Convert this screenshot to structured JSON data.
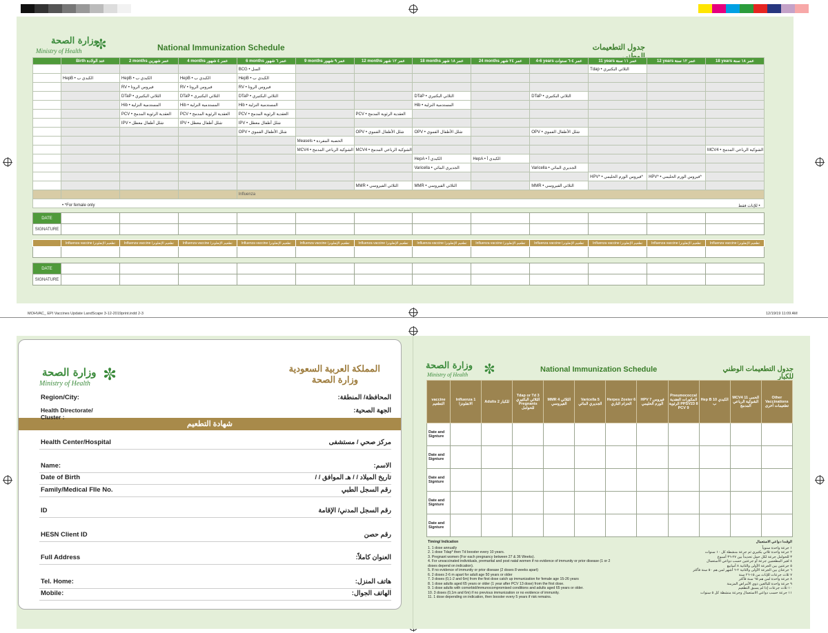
{
  "top_sheet": {
    "logo_ar": "وزارة الصحة",
    "logo_en": "Ministry of Health",
    "title_en": "National Immunization Schedule",
    "title_ar": "جدول التطعيمات الوطني",
    "columns": [
      "Birth عند الولادة",
      "2 months عمر شهرين",
      "4 months عمر ٤ شهور",
      "6 months عمر ٦ شهور",
      "9 months عمر ٩ شهور",
      "12 months عمر ١٢ شهر",
      "18 months عمر ١٨ شهر",
      "24 months عمر ٢٤ شهر",
      "4-6 years عمر ٤-٦ سنوات",
      "11 years عمر ١١ سنة",
      "12 years عمر ١٢ سنة",
      "18 years عمر ١٨ سنة"
    ],
    "rows": [
      [
        "",
        "",
        "",
        "BCG • السل",
        "",
        "",
        "",
        "",
        "",
        "Tdap • الثلاثي البكتيري",
        "",
        ""
      ],
      [
        "HepB • الكبدي ب",
        "HepB • الكبدي ب",
        "HepB • الكبدي ب",
        "HepB • الكبدي ب",
        "",
        "",
        "",
        "",
        "",
        "",
        "",
        ""
      ],
      [
        "",
        "RV • فيروس الروتا",
        "RV • فيروس الروتا",
        "RV • فيروس الروتا",
        "",
        "",
        "",
        "",
        "",
        "",
        "",
        ""
      ],
      [
        "",
        "DTaP • الثلاثي البكتيري",
        "DTaP • الثلاثي البكتيري",
        "DTaP • الثلاثي البكتيري",
        "",
        "",
        "DTaP • الثلاثي البكتيري",
        "",
        "DTaP • الثلاثي البكتيري",
        "",
        "",
        ""
      ],
      [
        "",
        "Hib • المستدمية النزلية",
        "Hib • المستدمية النزلية",
        "Hib • المستدمية النزلية",
        "",
        "",
        "Hib • المستدمية النزلية",
        "",
        "",
        "",
        "",
        ""
      ],
      [
        "",
        "PCV • العقدية الرئوية المدمج",
        "PCV • العقدية الرئوية المدمج",
        "PCV • العقدية الرئوية المدمج",
        "",
        "PCV • العقدية الرئوية المدمج",
        "",
        "",
        "",
        "",
        "",
        ""
      ],
      [
        "",
        "IPV • شلل أطفال معطل",
        "IPV • شلل أطفال معطل",
        "IPV • شلل أطفال معطل",
        "",
        "",
        "",
        "",
        "",
        "",
        "",
        ""
      ],
      [
        "",
        "",
        "",
        "OPV • شلل الأطفال الفموي",
        "",
        "OPV • شلل الأطفال الفموي",
        "OPV • شلل الأطفال الفموي",
        "",
        "OPV • شلل الأطفال الفموي",
        "",
        "",
        ""
      ],
      [
        "",
        "",
        "",
        "",
        "Measels • الحصبة المفردة",
        "",
        "",
        "",
        "",
        "",
        "",
        ""
      ],
      [
        "",
        "",
        "",
        "",
        "MCV4 • الحمى الشوكية الرباعي المدمج",
        "MCV4 • الحمى الشوكية الرباعي المدمج",
        "",
        "",
        "",
        "",
        "",
        "MCV4 • الحمى الشوكية الرباعي المدمج"
      ],
      [
        "",
        "",
        "",
        "",
        "",
        "",
        "HepA • الكبدي أ",
        "HepA • الكبدي أ",
        "",
        "",
        "",
        ""
      ],
      [
        "",
        "",
        "",
        "",
        "",
        "",
        "Varicella • الجديري المائي",
        "",
        "Varicella • الجديري المائي",
        "",
        "",
        ""
      ],
      [
        "",
        "",
        "",
        "",
        "",
        "",
        "",
        "",
        "",
        "HPV* • فيروس الورم الحليمي*",
        "HPV* • فيروس الورم الحليمي*",
        ""
      ],
      [
        "",
        "",
        "",
        "",
        "",
        "MMR • الثلاثي الفيروسي",
        "MMR • الثلاثي الفيروسي",
        "",
        "MMR • الثلاثي الفيروسي",
        "",
        "",
        ""
      ]
    ],
    "influenza_row": "Influenza",
    "footnote_en": "• *For female only",
    "footnote_ar": "• للإناث فقط",
    "date_label": "DATE",
    "signature_label": "SIGNATURE",
    "influenza_cols": "Influenza vaccine تطعيم الإنفلونزا"
  },
  "print_slug": {
    "file": "MOHVAC_ EPI Vaccines Update LandScape 3-12-2019print.indd   2-3",
    "date": "12/19/19   11:09 AM"
  },
  "certificate": {
    "kingdom_ar": "المملكة العربية السعودية",
    "ministry_ar": "وزارة الصحة",
    "logo_ar": "وزارة الصحة",
    "logo_en": "Ministry of Health",
    "banner": "شهادة التطعيم",
    "fields": [
      {
        "en": "Region/City:",
        "ar": "المحافظة/ المنطقة:"
      },
      {
        "en": "Health Directorate/ Cluster :",
        "ar": "الجهة الصحية:"
      },
      {
        "en": "Health Center/Hospital",
        "ar": "مركز صحي / مستشفى"
      },
      {
        "en": "Name:",
        "ar": "الاسم:"
      },
      {
        "en": "Date of Birth",
        "ar": "تاريخ الميلاد  /  /  هـ الموافق  /  /"
      },
      {
        "en": "Family/Medical FIle No.",
        "ar": "رقم السجل الطبي"
      },
      {
        "en": "ID",
        "ar": "رقم السجل المدني/ الإقامة"
      },
      {
        "en": "HESN Client ID",
        "ar": "رقم حصن"
      },
      {
        "en": "Full Address",
        "ar": "العنوان كاملاً:"
      },
      {
        "en": "Tel. Home:",
        "ar": "هاتف المنزل:"
      },
      {
        "en": "Mobile:",
        "ar": "الهاتف الجوال:"
      }
    ]
  },
  "adult_sheet": {
    "logo_ar": "وزارة الصحة",
    "logo_en": "Ministry of Health",
    "title_en": "National Immunization Schedule",
    "title_ar": "جدول التطعيمات الوطني للكبار",
    "headers": [
      "vaccine التطعيم",
      "Influenza 1 الانفلونزا",
      "Adults 2 للكبار",
      "Tdap or Td 3 الثلاثي البكتيري Pregnants للحوامل",
      "MMR 4 الثلاثي الفيروسي",
      "Varicella 5 الجديري المائي",
      "Herpes Zoster 6 الحزام الناري",
      "HPV 7 فيروس الورم الحليمي",
      "Pneumococcal المكورات العقدية الرئوية PPSV23 8 PCV 9",
      "Hep B 10 الكبدي ب",
      "MCV4 11 الحمى الشوكية الرباعي المدمج",
      "Other Vaccinations تطعيمات أخرى"
    ],
    "row_label": "Date and Signture",
    "notes_title": "Timing/ Indication",
    "notes": [
      "1.  1 dose annually",
      "2.  1 dose Tdap* then Td booster every 10 years.",
      "3.  Pregnant women (For each pregnancy between 27 & 36 Weeks).",
      "4.  For unvaccinated individuals, premarital and post natal women if no evidence of immunity or prior disease (1 or 2 doses depend on indication).",
      "5.  If no evidence of immunity or prior disease (2 doses 8 weeks apart)",
      "6.  2 doses 2-6 m apart for adult age 50 years or older",
      "7.  3 doses  (0,1-2 and 6m) from the first dose catch up immunization for female age 15-26 years",
      "8.  1 dose adults aged 65 years or older (1 year after PCV 13 dose) from the first dose.",
      "9.  1 dose adults with comorbid/immunocompromised conditions and adults aged  65 years or older.",
      "10. 3 doses (0,1m and 6m) if no previous immunization or no evidence of immunity.",
      "11. 1 dose depending on indication, then booster every 5 years if risk remains."
    ],
    "notes_title_ar": "الوقت/ دواعي الاستعمال",
    "notes_ar": [
      "١  جرعة واحدة سنوياً",
      "٢  جرعة واحدة ثلاثي بكتيري ثم جرعة منشطة كل ١٠ سنوات",
      "٣  للحوامل جرعة لكل حمل تحديداً بين ٢٧-٣٦ أسبوع",
      "٤  لغير المطعمين جرعة أو جرعتين حسب دواعي الاستعمال",
      "٥  جرعتين بين الجرعة الأولى والثانية ٨ أسابيع",
      "٦  جرعتان بين الجرعة الأولى والثانية ٢-٦ أشهر لمن هم ٥٠ سنة فأكثر",
      "٧  ثلاث جرعات للإناث من ١٥-٢٦ سنة",
      "٨  جرعة واحدة لمن هم ٦٥ سنة فأكثر",
      "٩  جرعة واحدة للبالغين ذوي الأمراض المزمنة",
      "١٠ ثلاث جرعات إذا لم يسبق التطعيم",
      "١١ جرعة حسب دواعي الاستعمال وجرعة منشطة كل ٥ سنوات"
    ]
  }
}
